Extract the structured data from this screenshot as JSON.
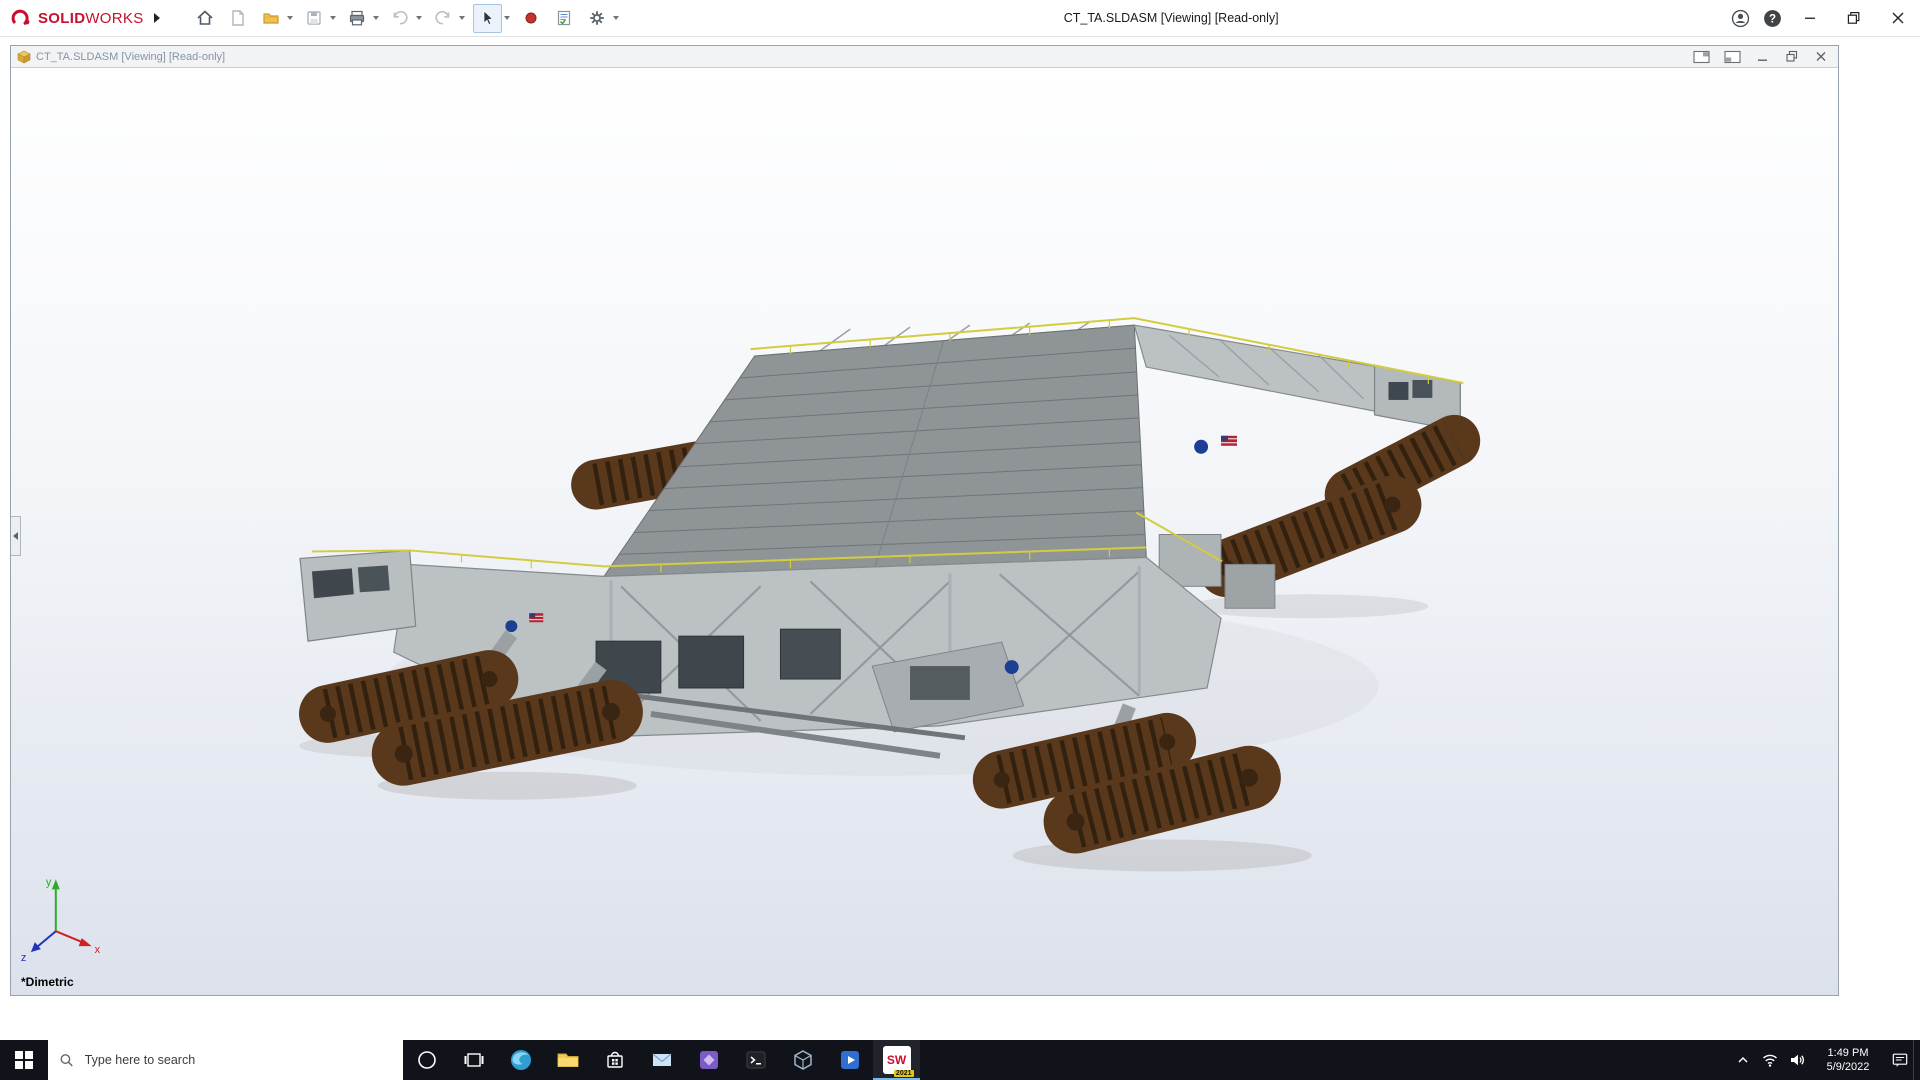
{
  "titlebar": {
    "brand_solid": "SOLID",
    "brand_works": "WORKS",
    "title": "CT_TA.SLDASM [Viewing] [Read-only]",
    "help_glyph": "?"
  },
  "docbar": {
    "title": "CT_TA.SLDASM [Viewing] [Read-only]"
  },
  "viewport": {
    "orientation_label": "*Dimetric",
    "triad": {
      "x": "x",
      "y": "y",
      "z": "z"
    }
  },
  "toolbar_icons": [
    "home",
    "new-document",
    "open",
    "save",
    "print",
    "undo",
    "redo",
    "select-cursor",
    "record",
    "properties",
    "settings"
  ],
  "taskbar": {
    "search_placeholder": "Type here to search",
    "solidworks": {
      "label": "SW",
      "year": "2021"
    },
    "clock": {
      "time": "1:49 PM",
      "date": "5/9/2022"
    }
  },
  "colors": {
    "brand_red": "#c8102e",
    "taskbar_bg": "#10131a",
    "track_brown": "#5a381c",
    "structure_gray": "#bcc1c3",
    "deck_gray": "#8f9597"
  }
}
